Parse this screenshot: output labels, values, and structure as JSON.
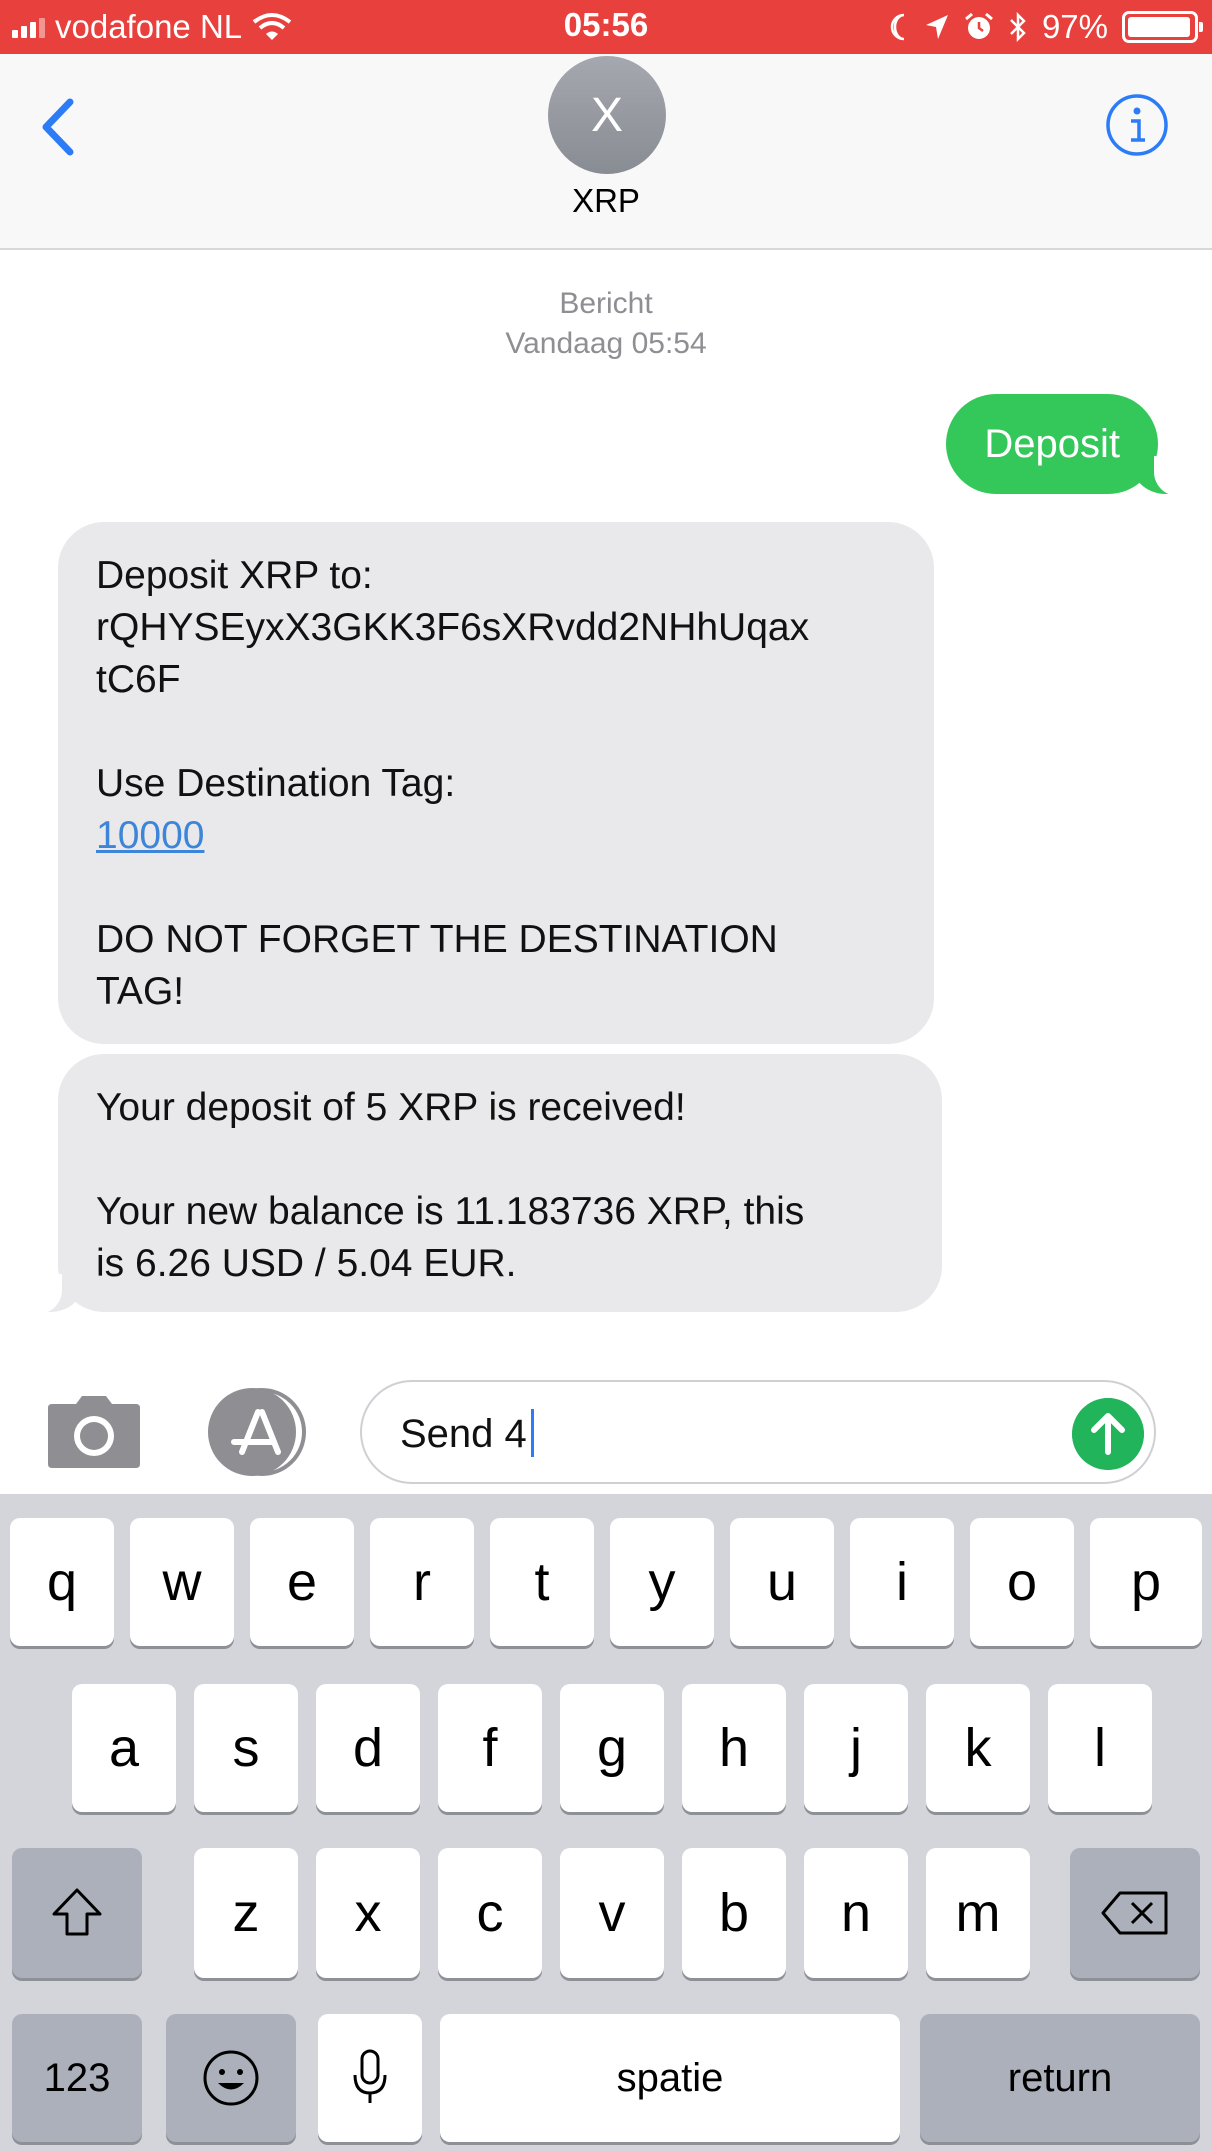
{
  "status_bar": {
    "carrier": "vodafone NL",
    "time": "05:56",
    "battery": "97%",
    "battery_fraction": 0.97,
    "color": "#e8403c"
  },
  "header": {
    "avatar_initial": "X",
    "contact_name": "XRP"
  },
  "thread": {
    "timestamp_label": "Bericht",
    "timestamp_day": "Vandaag",
    "timestamp_time": "05:54",
    "outgoing": "Deposit",
    "incoming_1": {
      "deposit_label": "Deposit XRP to:",
      "address": "rQHYSEyxX3GKK3F6sXRvdd2NHhUqax\ntC6F",
      "tag_label": "Use Destination Tag:",
      "tag": "10000",
      "warning": "DO NOT FORGET THE DESTINATION\nTAG!"
    },
    "incoming_2": {
      "received": "Your deposit of 5 XRP is received!",
      "balance": "Your new balance is 11.183736 XRP, this\nis 6.26 USD / 5.04 EUR."
    },
    "colors": {
      "outgoing": "#34c759",
      "incoming": "#e9e9eb",
      "link": "#3d85d8"
    }
  },
  "composer": {
    "text": "Send 4"
  },
  "keyboard": {
    "row1": [
      "q",
      "w",
      "e",
      "r",
      "t",
      "y",
      "u",
      "i",
      "o",
      "p"
    ],
    "row2": [
      "a",
      "s",
      "d",
      "f",
      "g",
      "h",
      "j",
      "k",
      "l"
    ],
    "row3": [
      "z",
      "x",
      "c",
      "v",
      "b",
      "n",
      "m"
    ],
    "numbers": "123",
    "space": "spatie",
    "return": "return"
  }
}
